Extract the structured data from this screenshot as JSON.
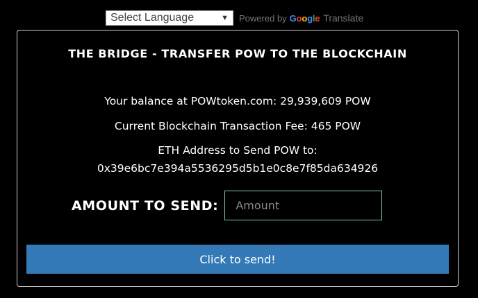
{
  "translate": {
    "select_value": "Select Language",
    "powered_by": "Powered by",
    "google": [
      "G",
      "o",
      "o",
      "g",
      "l",
      "e"
    ],
    "translate_word": "Translate"
  },
  "bridge": {
    "title": "THE BRIDGE - TRANSFER POW TO THE BLOCKCHAIN",
    "balance_line": "Your balance at POWtoken.com: 29,939,609 POW",
    "fee_line": "Current Blockchain Transaction Fee: 465 POW",
    "eth_label": "ETH Address to Send POW to:",
    "eth_address": "0x39e6bc7e394a5536295d5b1e0c8e7f85da634926",
    "amount_label": "AMOUNT TO SEND:",
    "amount_placeholder": "Amount",
    "amount_value": "",
    "send_label": "Click to send!"
  },
  "colors": {
    "background": "#000000",
    "button": "#337ab7",
    "input_border": "#7ed3a0",
    "panel_border": "#cfcfcf"
  }
}
